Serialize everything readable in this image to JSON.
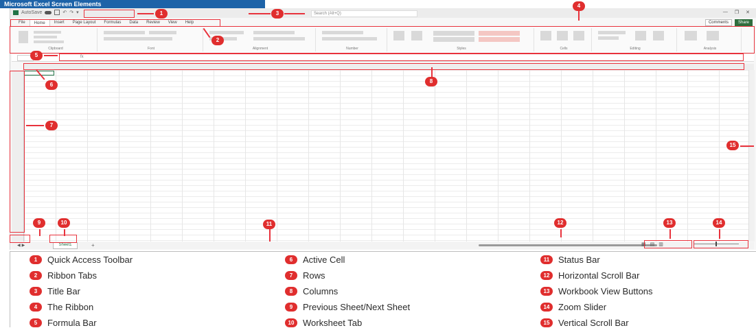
{
  "banner": {
    "title": "Microsoft Excel Screen Elements"
  },
  "titlebar": {
    "autosave_label": "AutoSave",
    "search_placeholder": "Search (Alt+Q)",
    "window_buttons": [
      "—",
      "❐",
      "✕"
    ]
  },
  "ribbon_tabs": [
    "File",
    "Home",
    "Insert",
    "Page Layout",
    "Formulas",
    "Data",
    "Review",
    "View",
    "Help"
  ],
  "ribbon_right": {
    "comments": "Comments",
    "share": "Share"
  },
  "ribbon_groups": [
    "Clipboard",
    "Font",
    "Alignment",
    "Number",
    "Styles",
    "Cells",
    "Editing",
    "Analysis"
  ],
  "formula_bar": {
    "name_box": "A1",
    "fx": "fx"
  },
  "sheets": {
    "tab_label": "Sheet1",
    "add_label": "+"
  },
  "view_buttons": [
    "▦",
    "▤",
    "▥"
  ],
  "badges": [
    "1",
    "2",
    "3",
    "4",
    "5",
    "6",
    "7",
    "8",
    "9",
    "10",
    "11",
    "12",
    "13",
    "14",
    "15"
  ],
  "legend": {
    "col1": [
      {
        "num": "1",
        "label": "Quick Access Toolbar"
      },
      {
        "num": "2",
        "label": "Ribbon Tabs"
      },
      {
        "num": "3",
        "label": "Title Bar"
      },
      {
        "num": "4",
        "label": "The Ribbon"
      },
      {
        "num": "5",
        "label": "Formula Bar"
      }
    ],
    "col2": [
      {
        "num": "6",
        "label": "Active Cell"
      },
      {
        "num": "7",
        "label": "Rows"
      },
      {
        "num": "8",
        "label": "Columns"
      },
      {
        "num": "9",
        "label": "Previous Sheet/Next Sheet"
      },
      {
        "num": "10",
        "label": "Worksheet Tab"
      }
    ],
    "col3": [
      {
        "num": "11",
        "label": "Status Bar"
      },
      {
        "num": "12",
        "label": "Horizontal Scroll Bar"
      },
      {
        "num": "13",
        "label": "Workbook View Buttons"
      },
      {
        "num": "14",
        "label": "Zoom Slider"
      },
      {
        "num": "15",
        "label": "Vertical Scroll Bar"
      }
    ]
  },
  "colors": {
    "badge": "#e02e2e",
    "banner": "#1d63a8",
    "excel_green": "#217346"
  }
}
